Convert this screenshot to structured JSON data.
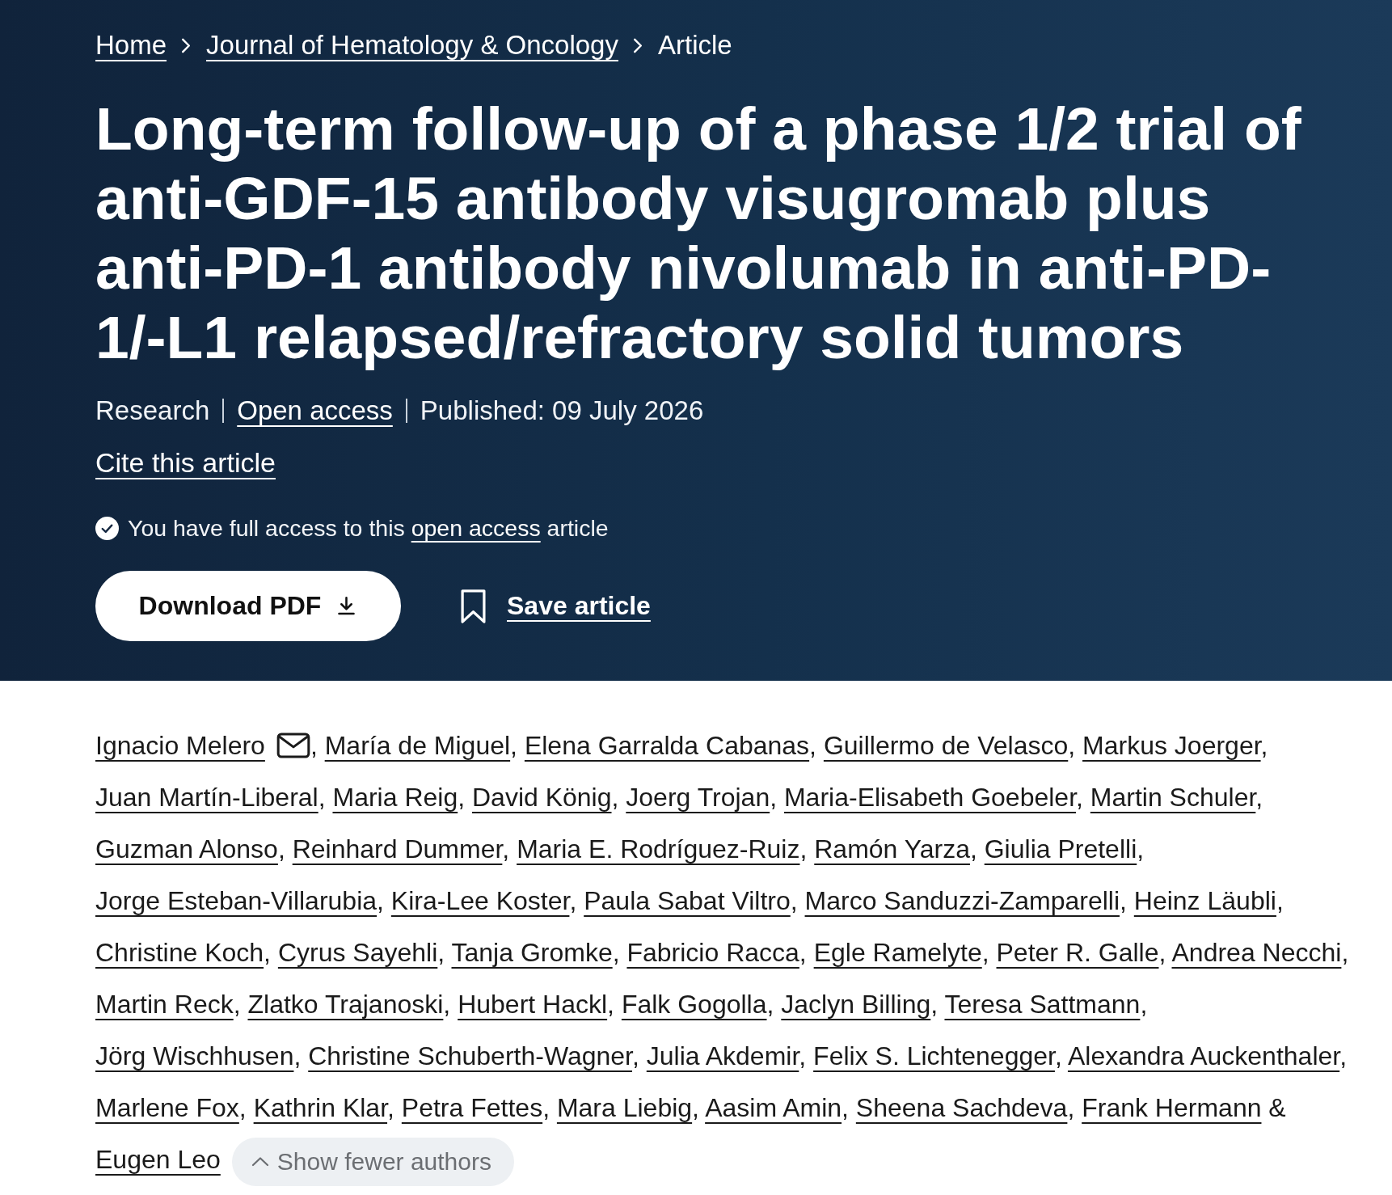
{
  "breadcrumb": [
    {
      "label": "Home",
      "current": false
    },
    {
      "label": "Journal of Hematology & Oncology",
      "current": false
    },
    {
      "label": "Article",
      "current": true
    }
  ],
  "title": "Long-term follow-up of a phase 1/2 trial of anti-GDF-15 antibody visugromab plus anti-PD-1 antibody nivolumab in anti-PD-1/-L1 relapsed/refractory solid tumors",
  "meta": [
    {
      "label": "Research",
      "link": false
    },
    {
      "label": "Open access",
      "link": true
    },
    {
      "label": "Published: 09 July 2026",
      "link": false
    }
  ],
  "cite_link": "Cite this article",
  "access_notice": {
    "text_before": "You have full access to this",
    "link": "open access",
    "text_after": "article"
  },
  "actions": {
    "download_button": "Download PDF",
    "save_button": "Save article"
  },
  "authors": [
    {
      "name": "Ignacio Melero",
      "email": true,
      "separator": ","
    },
    {
      "name": "María de Miguel",
      "email": false,
      "separator": ","
    },
    {
      "name": "Elena Garralda Cabanas",
      "email": false,
      "separator": ","
    },
    {
      "name": "Guillermo de Velasco",
      "email": false,
      "separator": ","
    },
    {
      "name": "Markus Joerger",
      "email": false,
      "separator": ","
    },
    {
      "name": "Juan Martín-Liberal",
      "email": false,
      "separator": ","
    },
    {
      "name": "Maria Reig",
      "email": false,
      "separator": ","
    },
    {
      "name": "David König",
      "email": false,
      "separator": ","
    },
    {
      "name": "Joerg Trojan",
      "email": false,
      "separator": ","
    },
    {
      "name": "Maria-Elisabeth Goebeler",
      "email": false,
      "separator": ","
    },
    {
      "name": "Martin Schuler",
      "email": false,
      "separator": ","
    },
    {
      "name": "Guzman Alonso",
      "email": false,
      "separator": ","
    },
    {
      "name": "Reinhard Dummer",
      "email": false,
      "separator": ","
    },
    {
      "name": "Maria E. Rodríguez-Ruiz",
      "email": false,
      "separator": ","
    },
    {
      "name": "Ramón Yarza",
      "email": false,
      "separator": ","
    },
    {
      "name": "Giulia Pretelli",
      "email": false,
      "separator": ","
    },
    {
      "name": "Jorge Esteban-Villarubia",
      "email": false,
      "separator": ","
    },
    {
      "name": "Kira-Lee Koster",
      "email": false,
      "separator": ","
    },
    {
      "name": "Paula Sabat Viltro",
      "email": false,
      "separator": ","
    },
    {
      "name": "Marco Sanduzzi-Zamparelli",
      "email": false,
      "separator": ","
    },
    {
      "name": "Heinz Läubli",
      "email": false,
      "separator": ","
    },
    {
      "name": "Christine Koch",
      "email": false,
      "separator": ","
    },
    {
      "name": "Cyrus Sayehli",
      "email": false,
      "separator": ","
    },
    {
      "name": "Tanja Gromke",
      "email": false,
      "separator": ","
    },
    {
      "name": "Fabricio Racca",
      "email": false,
      "separator": ","
    },
    {
      "name": "Egle Ramelyte",
      "email": false,
      "separator": ","
    },
    {
      "name": "Peter R. Galle",
      "email": false,
      "separator": ","
    },
    {
      "name": "Andrea Necchi",
      "email": false,
      "separator": ","
    },
    {
      "name": "Martin Reck",
      "email": false,
      "separator": ","
    },
    {
      "name": "Zlatko Trajanoski",
      "email": false,
      "separator": ","
    },
    {
      "name": "Hubert Hackl",
      "email": false,
      "separator": ","
    },
    {
      "name": "Falk Gogolla",
      "email": false,
      "separator": ","
    },
    {
      "name": "Jaclyn Billing",
      "email": false,
      "separator": ","
    },
    {
      "name": "Teresa Sattmann",
      "email": false,
      "separator": ","
    },
    {
      "name": "Jörg Wischhusen",
      "email": false,
      "separator": ","
    },
    {
      "name": "Christine Schuberth-Wagner",
      "email": false,
      "separator": ","
    },
    {
      "name": "Julia Akdemir",
      "email": false,
      "separator": ","
    },
    {
      "name": "Felix S. Lichtenegger",
      "email": false,
      "separator": ","
    },
    {
      "name": "Alexandra Auckenthaler",
      "email": false,
      "separator": ","
    },
    {
      "name": "Marlene Fox",
      "email": false,
      "separator": ","
    },
    {
      "name": "Kathrin Klar",
      "email": false,
      "separator": ","
    },
    {
      "name": "Petra Fettes",
      "email": false,
      "separator": ","
    },
    {
      "name": "Mara Liebig",
      "email": false,
      "separator": ","
    },
    {
      "name": "Aasim Amin",
      "email": false,
      "separator": ","
    },
    {
      "name": "Sheena Sachdeva",
      "email": false,
      "separator": ","
    },
    {
      "name": "Frank Hermann",
      "email": false,
      "separator": " &"
    },
    {
      "name": "Eugen Leo",
      "email": false
    }
  ],
  "authors_toggle": "Show fewer authors"
}
